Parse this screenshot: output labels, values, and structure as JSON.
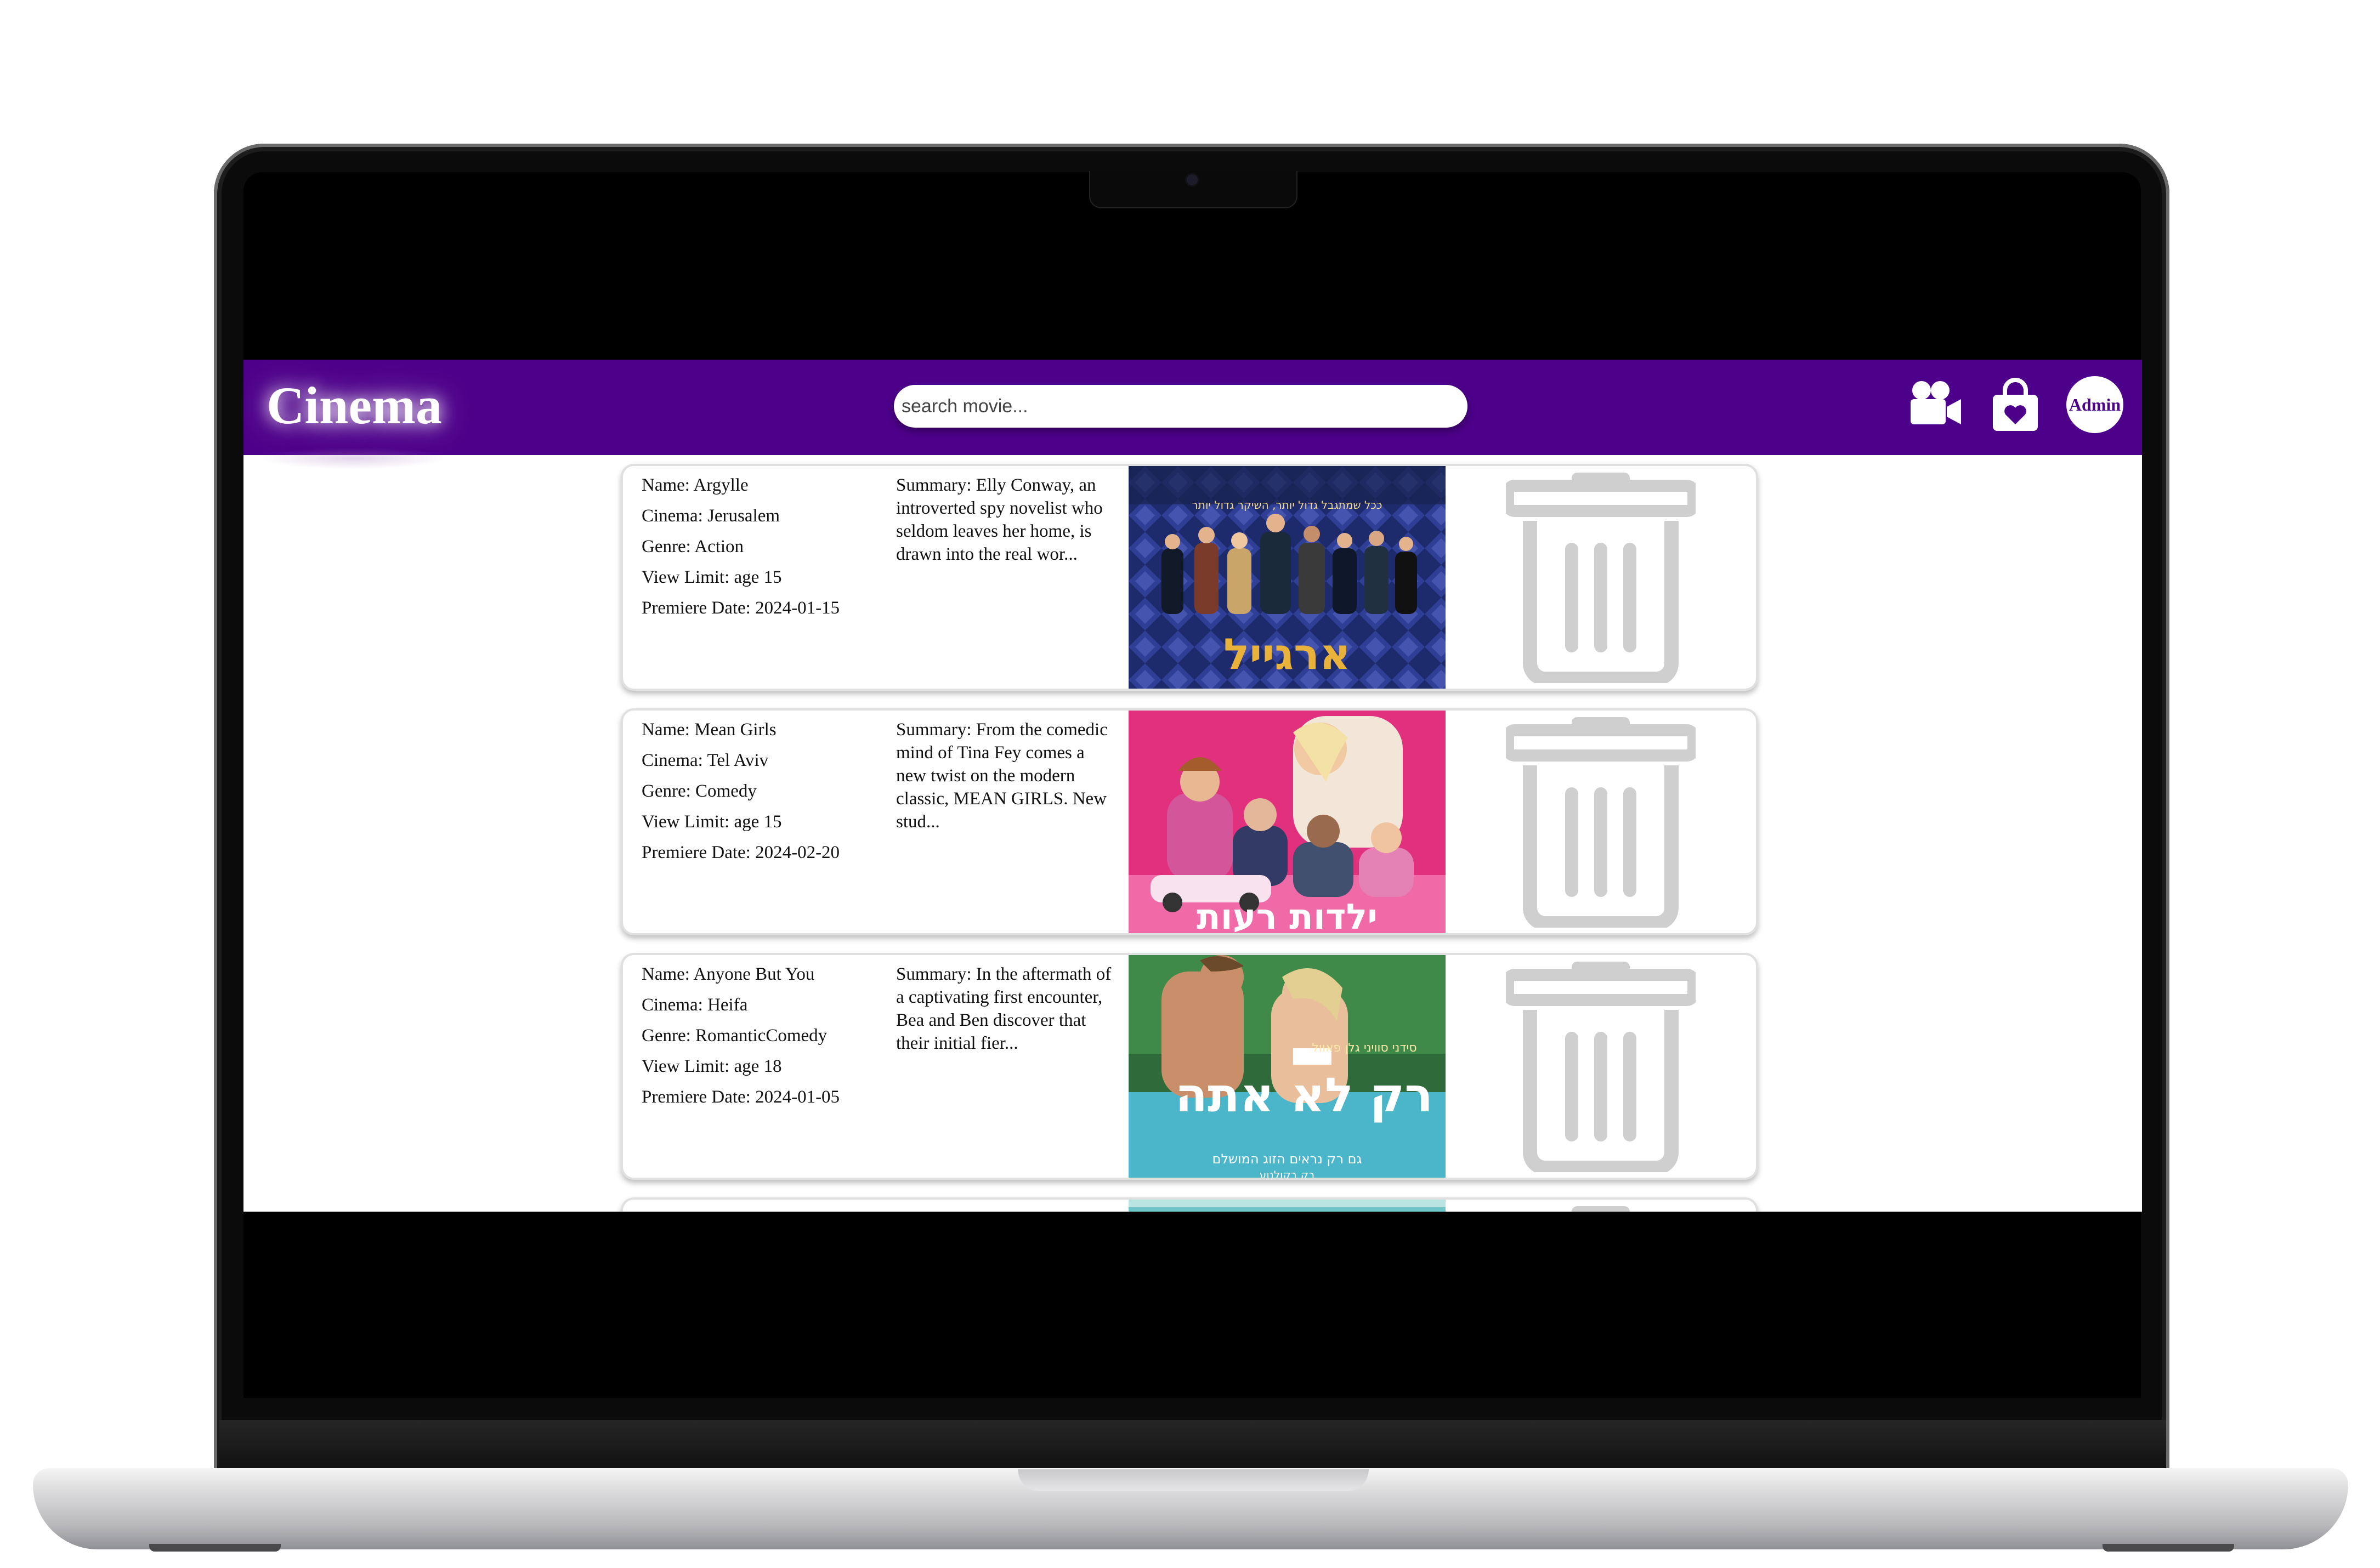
{
  "app": {
    "brand": "Cinema",
    "search": {
      "placeholder": "search movie..."
    },
    "nav": {
      "movies_icon": "video-camera-icon",
      "bag_icon": "shopping-bag-heart-icon",
      "avatar_label": "Admin"
    }
  },
  "labels": {
    "name": "Name:",
    "cinema": "Cinema:",
    "genre": "Genre:",
    "view_limit": "View Limit:",
    "premiere": "Premiere Date:",
    "summary": "Summary:"
  },
  "movies": [
    {
      "name": "Argylle",
      "cinema": "Jerusalem",
      "genre": "Action",
      "view_limit": "age 15",
      "premiere_date": "2024-01-15",
      "summary": "Elly Conway, an introverted spy novelist who seldom leaves her home, is drawn into the real wor...",
      "poster_title": "ארגייל",
      "poster_tagline": "ככל שמתגבל גדול יותר, השיקר גדול יותר"
    },
    {
      "name": "Mean Girls",
      "cinema": "Tel Aviv",
      "genre": "Comedy",
      "view_limit": "age 15",
      "premiere_date": "2024-02-20",
      "summary": "From the comedic mind of Tina Fey comes a new twist on the modern classic, MEAN GIRLS. New stud...",
      "poster_title": "ילדות רעות"
    },
    {
      "name": "Anyone But You",
      "cinema": "Heifa",
      "genre": "RomanticComedy",
      "view_limit": "age 18",
      "premiere_date": "2024-01-05",
      "summary": "In the aftermath of a captivating first encounter, Bea and Ben discover that their initial fier...",
      "poster_title": "רק לא אתה",
      "poster_names": "סידני סוויני   גלן פאוול",
      "poster_tagline": "גם רק נראים הזוג המושלם",
      "poster_director": "רק בקולנוע"
    }
  ],
  "colors": {
    "navbar": "#4d008a",
    "trash": "#cfcfcf"
  }
}
